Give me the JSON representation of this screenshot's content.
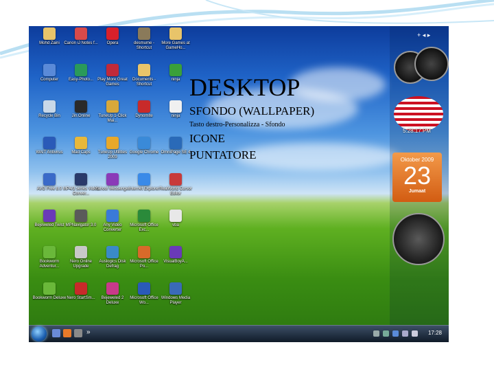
{
  "overlay": {
    "title": "DESKTOP",
    "lines": [
      "SFONDO (WALLPAPER)",
      "Tasto destro-Personalizza - Sfondo",
      "ICONE",
      "PUNTATORE"
    ]
  },
  "desktop_icons": [
    {
      "label": "Mohd Zaini",
      "color": "#e8c46a"
    },
    {
      "label": "Canon iJ Notes f...",
      "color": "#d84a4a"
    },
    {
      "label": "Opera",
      "color": "#d8202a"
    },
    {
      "label": "desmume - Shortcut",
      "color": "#8a7a5a"
    },
    {
      "label": "More Games at GameHo...",
      "color": "#e8c46a"
    },
    {
      "label": "Computer",
      "color": "#5a8ad8"
    },
    {
      "label": "Easy-Photo...",
      "color": "#2a9a5a"
    },
    {
      "label": "Play More Great Games",
      "color": "#c02a3a"
    },
    {
      "label": "Documents - Shortcut",
      "color": "#e8c46a"
    },
    {
      "label": "ninja",
      "color": "#3aa03a"
    },
    {
      "label": "Recycle Bin",
      "color": "#c8d8e8"
    },
    {
      "label": "Jin.Online",
      "color": "#2a2a2a"
    },
    {
      "label": "TuneUp 1-Click Mai...",
      "color": "#d8a83a"
    },
    {
      "label": "Dynomite",
      "color": "#c82a2a"
    },
    {
      "label": "ninja",
      "color": "#f0f0f0"
    },
    {
      "label": "WAIT Antivirus",
      "color": "#2a5ab8"
    },
    {
      "label": "Mad Caps",
      "color": "#e8b83a"
    },
    {
      "label": "TuneUp Utilities 2009",
      "color": "#e8a82a"
    },
    {
      "label": "Google Chrome",
      "color": "#3a8ad8"
    },
    {
      "label": "OmniPage SE 4",
      "color": "#2a6ab8"
    },
    {
      "label": "AVG Free 8.0",
      "color": "#3a6ac8"
    },
    {
      "label": "MP4/3 series Video Conver...",
      "color": "#2a3a6a"
    },
    {
      "label": "Yahoo! Messenger",
      "color": "#8a3ab8"
    },
    {
      "label": "Internet Explorer",
      "color": "#3a8ae8"
    },
    {
      "label": "RealWorld Cursor Editor",
      "color": "#c83a3a"
    },
    {
      "label": "Bejeweled Twist",
      "color": "#6a3ab8"
    },
    {
      "label": "MPNavigator 3.0",
      "color": "#5a5a5a"
    },
    {
      "label": "Any Video Converter",
      "color": "#3a7ad8"
    },
    {
      "label": "Microsoft Office Exc...",
      "color": "#2a8a3a"
    },
    {
      "label": "vba",
      "color": "#e8e8e8"
    },
    {
      "label": "Bookworm Adventur...",
      "color": "#6ab83a"
    },
    {
      "label": "Nero Online Upgrade",
      "color": "#c8c8c8"
    },
    {
      "label": "Auslogics Disk Defrag",
      "color": "#3a8ac8"
    },
    {
      "label": "Microsoft Office Po...",
      "color": "#d86a2a"
    },
    {
      "label": "VisualBoyA...",
      "color": "#6a3ab8"
    },
    {
      "label": "Bookworm Deluxe",
      "color": "#6ab83a"
    },
    {
      "label": "Nero StartSm...",
      "color": "#c82a2a"
    },
    {
      "label": "Bejeweled 2 Deluxe",
      "color": "#c83a8a"
    },
    {
      "label": "Microsoft Office Wo...",
      "color": "#2a5ab8"
    },
    {
      "label": "Windows Media Player",
      "color": "#3a6ab8"
    }
  ],
  "gadgets": {
    "top_controls": "+ ◂ ▸",
    "flag_time": "5:28:17 PM",
    "calendar_month": "Oktober 2009",
    "calendar_day": "23",
    "calendar_weekday": "Jumaat"
  },
  "taskbar": {
    "more_label": "»",
    "clock": "17:28"
  },
  "colors": {
    "accent": "#3a6fd0",
    "wave": "#a9d3ee"
  }
}
